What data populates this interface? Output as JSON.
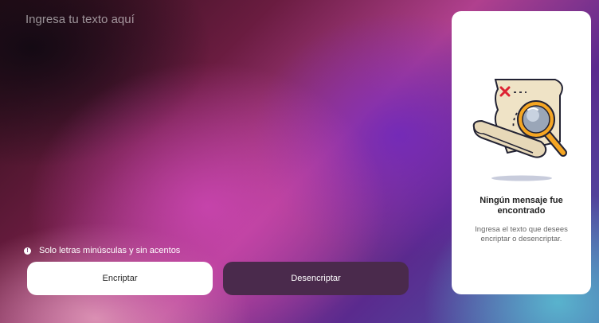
{
  "input": {
    "placeholder": "Ingresa tu texto aquí"
  },
  "hint": {
    "text": "Solo letras minúsculas y sin acentos",
    "icon": "info-icon"
  },
  "buttons": {
    "encrypt": "Encriptar",
    "decrypt": "Desencriptar"
  },
  "panel": {
    "title": "Ningún mensaje fue encontrado",
    "body": "Ingresa el texto que desees encriptar o desencriptar.",
    "illustration": "treasure-map-magnifier-illustration"
  },
  "colors": {
    "encrypt_bg": "#ffffff",
    "decrypt_bg": "#4a2a4c",
    "panel_bg": "#ffffff"
  }
}
